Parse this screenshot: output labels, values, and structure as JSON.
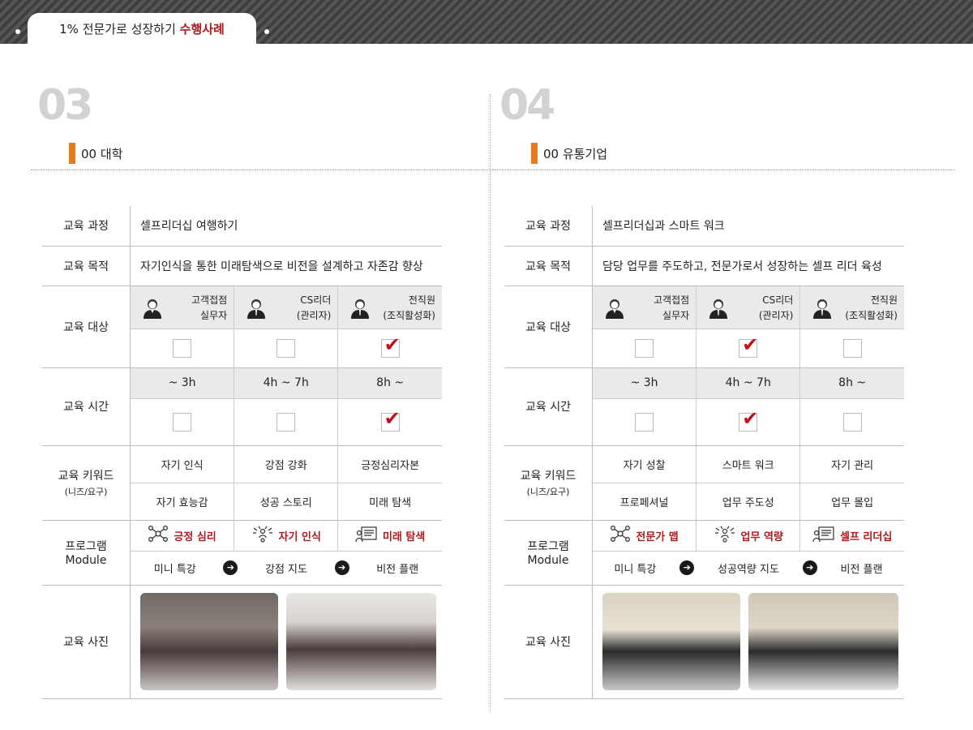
{
  "header": {
    "title_prefix": "1% 전문가로 성장하기 ",
    "title_highlight": "수행사례"
  },
  "sections": [
    {
      "num": "03",
      "org": "00 대학",
      "labels": {
        "course": "교육 과정",
        "goal": "교육 목적",
        "target": "교육 대상",
        "time": "교육 시간",
        "keyword": "교육 키워드",
        "keyword_sub": "(니즈/요구)",
        "program": "프로그램",
        "program_sub": "Module",
        "photo": "교육 사진"
      },
      "course": "셀프리더십 여행하기",
      "goal": "자기인식을 통한 미래탐색으로 비전을 설계하고 자존감 향상",
      "targets": [
        {
          "l1": "고객접점",
          "l2": "실무자",
          "checked": false
        },
        {
          "l1": "CS리더",
          "l2": "(관리자)",
          "checked": false
        },
        {
          "l1": "전직원",
          "l2": "(조직활성화)",
          "checked": true
        }
      ],
      "times": [
        {
          "label": "~ 3h",
          "checked": false
        },
        {
          "label": "4h ~ 7h",
          "checked": false
        },
        {
          "label": "8h ~",
          "checked": true
        }
      ],
      "keywords": [
        "자기 인식",
        "강점 강화",
        "긍정심리자본",
        "자기 효능감",
        "성공 스토리",
        "미래 탐색"
      ],
      "modules": [
        {
          "icon": "network-icon",
          "label": "긍정 심리"
        },
        {
          "icon": "team-icon",
          "label": "자기 인식"
        },
        {
          "icon": "board-icon",
          "label": "미래 탐색"
        }
      ],
      "flow": [
        "미니 특강",
        "강점 지도",
        "비전 플랜"
      ]
    },
    {
      "num": "04",
      "org": "00 유통기업",
      "labels": {
        "course": "교육 과정",
        "goal": "교육 목적",
        "target": "교육 대상",
        "time": "교육 시간",
        "keyword": "교육 키워드",
        "keyword_sub": "(니즈/요구)",
        "program": "프로그램",
        "program_sub": "Module",
        "photo": "교육 사진"
      },
      "course": "셀프리더십과 스마트 워크",
      "goal": "담당 업무를 주도하고, 전문가로서 성장하는 셀프 리더 육성",
      "targets": [
        {
          "l1": "고객접점",
          "l2": "실무자",
          "checked": false
        },
        {
          "l1": "CS리더",
          "l2": "(관리자)",
          "checked": true
        },
        {
          "l1": "전직원",
          "l2": "(조직활성화)",
          "checked": false
        }
      ],
      "times": [
        {
          "label": "~ 3h",
          "checked": false
        },
        {
          "label": "4h ~ 7h",
          "checked": true
        },
        {
          "label": "8h ~",
          "checked": false
        }
      ],
      "keywords": [
        "자기 성찰",
        "스마트 워크",
        "자기 관리",
        "프로페셔널",
        "업무 주도성",
        "업무 몰입"
      ],
      "modules": [
        {
          "icon": "network-icon",
          "label": "전문가 맵"
        },
        {
          "icon": "team-icon",
          "label": "업무 역량"
        },
        {
          "icon": "board-icon",
          "label": "셀프 리더십"
        }
      ],
      "flow": [
        "미니 특강",
        "성공역량 지도",
        "비전 플랜"
      ]
    }
  ],
  "colors": {
    "accent": "#b0181c",
    "orange": "#e87a1a",
    "check": "#c0111a"
  }
}
